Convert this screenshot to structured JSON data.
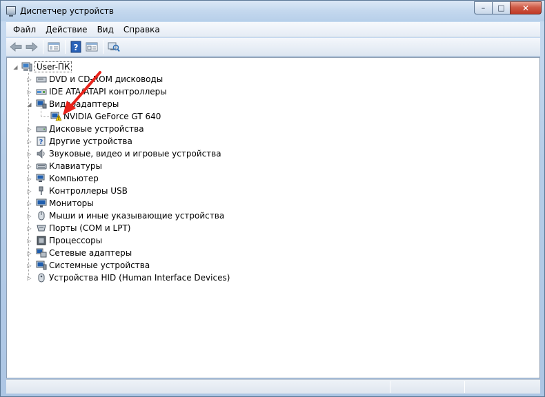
{
  "window": {
    "title": "Диспетчер устройств"
  },
  "caption_buttons": {
    "minimize": "–",
    "maximize": "□",
    "close": "✕"
  },
  "menu": [
    "Файл",
    "Действие",
    "Вид",
    "Справка"
  ],
  "toolbar": [
    "back-icon",
    "forward-icon",
    "show-hide-tree-icon",
    "help-icon",
    "properties-icon",
    "scan-hardware-icon"
  ],
  "tree": {
    "root": "User-ПК",
    "categories": [
      {
        "label": "DVD и CD-ROM дисководы",
        "icon": "dvd-drive-icon",
        "expanded": false
      },
      {
        "label": "IDE ATA/ATAPI контроллеры",
        "icon": "ide-controller-icon",
        "expanded": false
      },
      {
        "label": "Видеоадаптеры",
        "icon": "display-adapter-icon",
        "expanded": true,
        "children": [
          {
            "label": "NVIDIA GeForce GT 640",
            "icon": "warning-display-adapter-icon",
            "warning": true
          }
        ]
      },
      {
        "label": "Дисковые устройства",
        "icon": "disk-drive-icon",
        "expanded": false
      },
      {
        "label": "Другие устройства",
        "icon": "unknown-device-icon",
        "expanded": false
      },
      {
        "label": "Звуковые, видео и игровые устройства",
        "icon": "speaker-icon",
        "expanded": false
      },
      {
        "label": "Клавиатуры",
        "icon": "keyboard-icon",
        "expanded": false
      },
      {
        "label": "Компьютер",
        "icon": "computer-icon",
        "expanded": false
      },
      {
        "label": "Контроллеры USB",
        "icon": "usb-icon",
        "expanded": false
      },
      {
        "label": "Мониторы",
        "icon": "monitor-icon",
        "expanded": false
      },
      {
        "label": "Мыши и иные указывающие устройства",
        "icon": "mouse-icon",
        "expanded": false
      },
      {
        "label": "Порты (COM и LPT)",
        "icon": "port-icon",
        "expanded": false
      },
      {
        "label": "Процессоры",
        "icon": "processor-icon",
        "expanded": false
      },
      {
        "label": "Сетевые адаптеры",
        "icon": "network-adapter-icon",
        "expanded": false
      },
      {
        "label": "Системные устройства",
        "icon": "system-device-icon",
        "expanded": false
      },
      {
        "label": "Устройства HID (Human Interface Devices)",
        "icon": "hid-icon",
        "expanded": false
      }
    ]
  },
  "colors": {
    "annotation_arrow": "#e8231b",
    "warning": "#f5d000"
  }
}
